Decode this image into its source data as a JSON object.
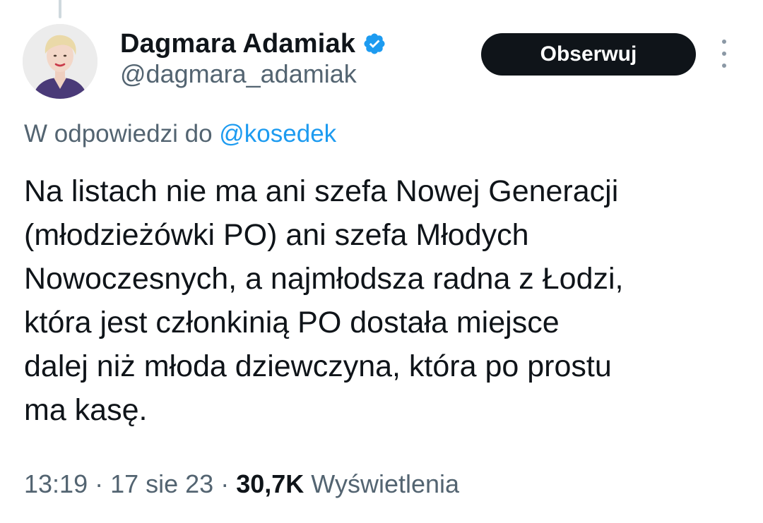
{
  "author": {
    "display_name": "Dagmara Adamiak",
    "handle": "@dagmara_adamiak",
    "verified_icon": "verified-badge-icon",
    "verified_color": "#1d9bf0"
  },
  "actions": {
    "follow_label": "Obserwuj",
    "more_icon": "more-vertical-icon"
  },
  "reply": {
    "prefix": "W odpowiedzi do",
    "mention": "@kosedek"
  },
  "tweet": {
    "text": "Na listach nie ma ani szefa Nowej Generacji\n(młodzieżówki PO) ani szefa Młodych\nNowoczesnych, a najmłodsza radna z Łodzi,\nktóra jest członkinią PO dostała miejsce\ndalej niż młoda dziewczyna, która po prostu\nma kasę."
  },
  "meta": {
    "time": "13:19",
    "date": "17 sie 23",
    "separator": "·",
    "views_count": "30,7K",
    "views_label": "Wyświetlenia"
  },
  "colors": {
    "text": "#0f1419",
    "secondary": "#536471",
    "link": "#1d9bf0",
    "button_bg": "#0f1419"
  }
}
